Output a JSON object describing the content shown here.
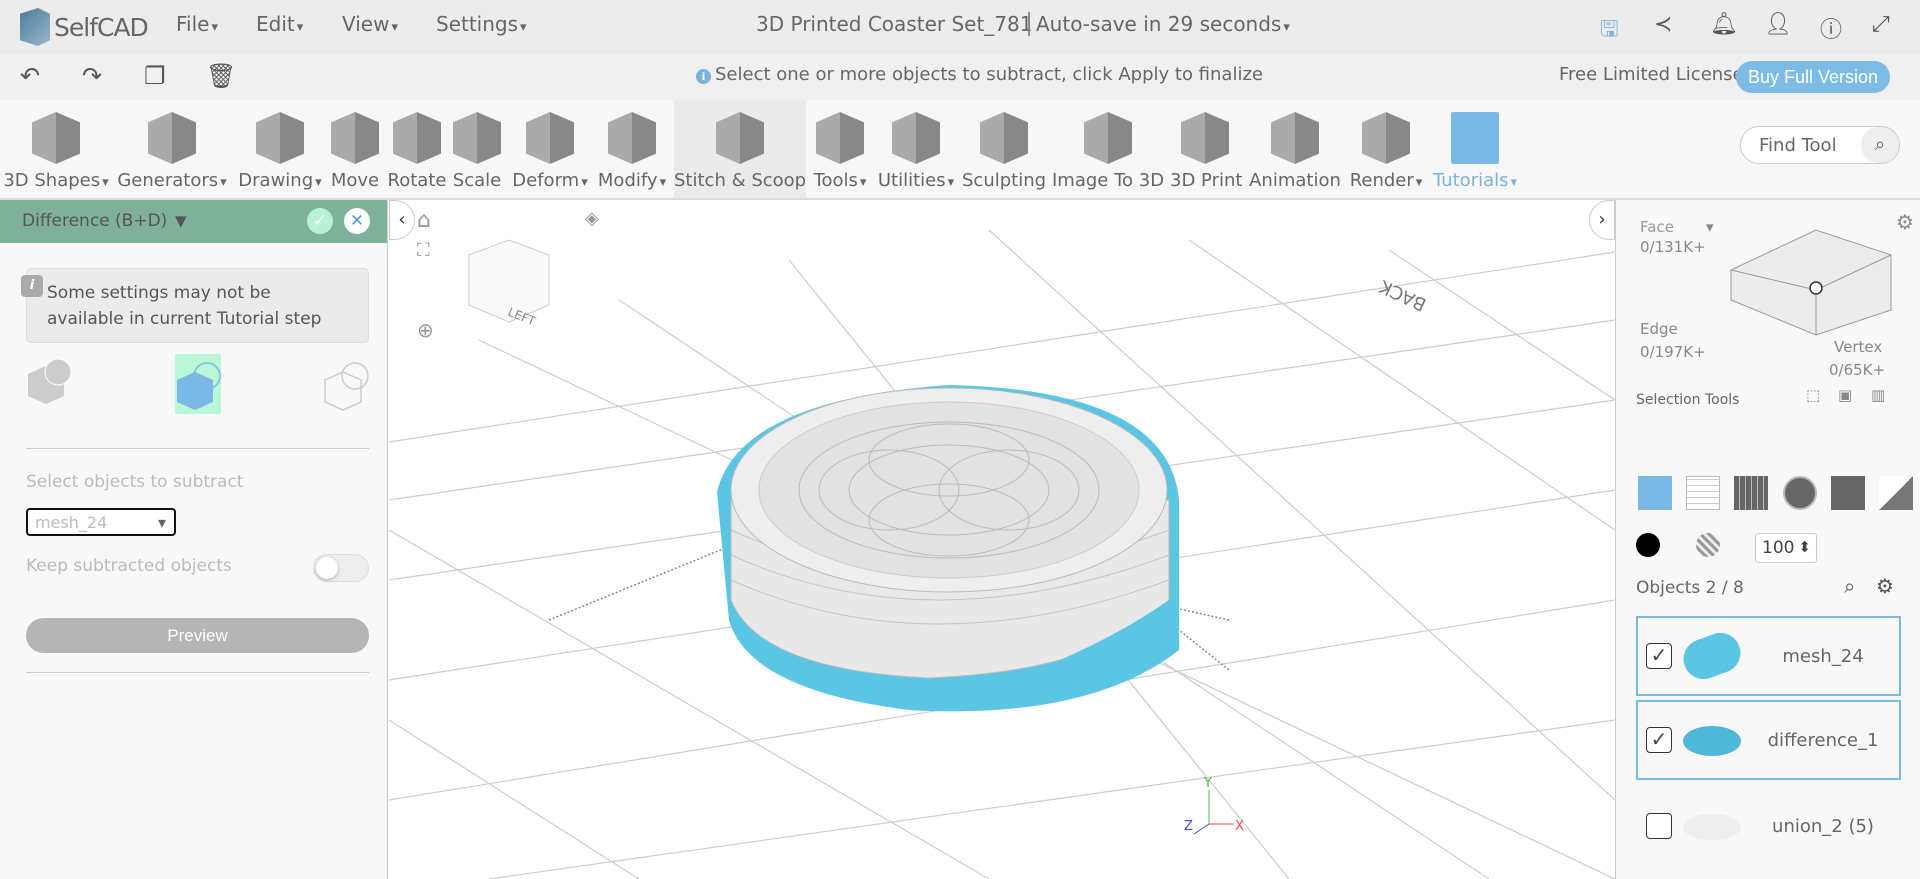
{
  "app": {
    "name": "SelfCAD",
    "menus": [
      "File",
      "Edit",
      "View",
      "Settings"
    ],
    "project_title": "3D Printed Coaster Set_781",
    "autosave": "Auto-save in 29 seconds"
  },
  "header_icons": [
    "save-icon",
    "share-icon",
    "bell-icon",
    "user-icon",
    "info-icon",
    "fullscreen-icon"
  ],
  "actionbar": {
    "hint": "Select one or more objects to subtract, click Apply to finalize",
    "license": "Free Limited License",
    "buy_label": "Buy Full Version"
  },
  "tools": [
    "3D Shapes",
    "Generators",
    "Drawing",
    "Move",
    "Rotate",
    "Scale",
    "Deform",
    "Modify",
    "Stitch & Scoop",
    "Tools",
    "Utilities",
    "Sculpting",
    "Image To 3D",
    "3D Print",
    "Animation",
    "Render",
    "Tutorials"
  ],
  "find_tool": {
    "placeholder": "Find Tool"
  },
  "left_panel": {
    "title": "Difference (B+D)",
    "note": "Some settings may not be available in current Tutorial step",
    "select_label": "Select objects to subtract",
    "select_value": "mesh_24",
    "keep_label": "Keep subtracted objects",
    "keep_value": false,
    "preview_label": "Preview"
  },
  "viewport": {
    "cube_label": "LEFT",
    "back_label": "BACK",
    "axes": {
      "x": "X",
      "y": "Y",
      "z": "Z"
    }
  },
  "right_panel": {
    "face_label": "Face",
    "face_count": "0/131K+",
    "edge_label": "Edge",
    "edge_count": "0/197K+",
    "vertex_label": "Vertex",
    "vertex_count": "0/65K+",
    "selection_tools": "Selection Tools",
    "opacity": "100",
    "objects_header": "Objects 2 / 8",
    "objects": [
      {
        "name": "mesh_24",
        "checked": true,
        "selected": true
      },
      {
        "name": "difference_1",
        "checked": true,
        "selected": true
      },
      {
        "name": "union_2 (5)",
        "checked": false,
        "selected": false
      }
    ]
  },
  "colors": {
    "accent": "#7dbce6",
    "panel_header": "#7fb09a",
    "object_blue": "#5bc6e4"
  }
}
